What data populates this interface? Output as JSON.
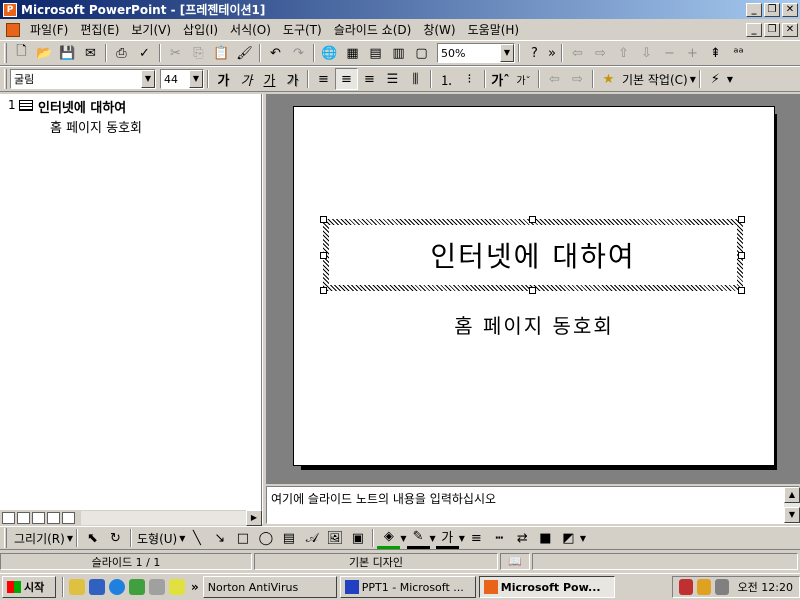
{
  "window": {
    "title": "Microsoft PowerPoint - [프레젠테이션1]"
  },
  "menu": {
    "items": [
      "파일(F)",
      "편집(E)",
      "보기(V)",
      "삽입(I)",
      "서식(O)",
      "도구(T)",
      "슬라이드 쇼(D)",
      "창(W)",
      "도움말(H)"
    ]
  },
  "toolbar_std": {
    "zoom": "50%",
    "help_glyph": "?"
  },
  "toolbar_fmt": {
    "font": "굴림",
    "size": "44",
    "bold": "가",
    "italic": "가",
    "underline": "가",
    "shadow": "가",
    "common_tasks": "기본 작업(C)"
  },
  "outline": {
    "slide_number": "1",
    "title": "인터넷에 대하여",
    "subtitle": "홈 페이지 동호회"
  },
  "slide": {
    "title": "인터넷에 대하여",
    "subtitle": "홈 페이지 동호회"
  },
  "notes": {
    "placeholder": "여기에 슬라이드 노트의 내용을 입력하십시오"
  },
  "draw_toolbar": {
    "draw": "그리기(R)",
    "autoshapes": "도형(U)"
  },
  "status": {
    "slide": "슬라이드 1 / 1",
    "design": "기본 디자인"
  },
  "taskbar": {
    "start": "시작",
    "chevron": "»",
    "tasks": [
      "Norton AntiVirus",
      "PPT1 - Microsoft ...",
      "Microsoft Pow..."
    ],
    "clock": "오전 12:20"
  },
  "colors": {
    "title_bar_start": "#0a246a",
    "title_bar_end": "#a6caf0",
    "chrome": "#d4d0c8",
    "slide_area": "#808080"
  }
}
